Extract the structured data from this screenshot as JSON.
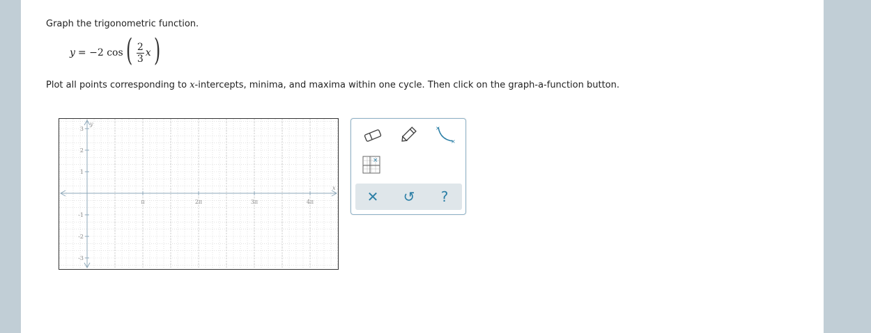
{
  "instruction": "Graph the trigonometric function.",
  "equation": {
    "lhs": "y",
    "equals": "= −2 cos",
    "numerator": "2",
    "denominator": "3",
    "var": "x"
  },
  "plot_instruction": {
    "before": "Plot all points corresponding to ",
    "var": "x",
    "after": "-intercepts, minima, and maxima within one cycle. Then click on the graph-a-function button."
  },
  "graph": {
    "x_axis_label": "x",
    "y_axis_label": "y",
    "x_ticks": [
      "π",
      "2π",
      "3π",
      "4π"
    ],
    "y_ticks": [
      "3",
      "2",
      "1",
      "-1",
      "-2",
      "-3"
    ],
    "x_range": [
      "-1.5",
      "4.5π"
    ],
    "y_range": [
      -3.5,
      3.5
    ],
    "grid": "on"
  },
  "tools": {
    "eraser": "eraser-icon",
    "pencil": "pencil-icon",
    "curve": "sinusoid-curve-icon",
    "graph_function": "graph-a-function-icon",
    "clear": "✕",
    "undo": "↺",
    "help": "?"
  },
  "colors": {
    "page_bg": "#c1ced6",
    "accent": "#2c7fa6",
    "grid": "#c8c8c8",
    "axis": "#8da7b8"
  }
}
